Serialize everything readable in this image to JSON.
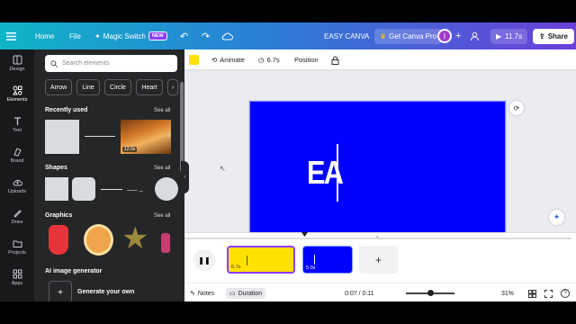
{
  "topbar": {
    "home": "Home",
    "file": "File",
    "magic_switch": "Magic Switch",
    "new_badge": "NEW",
    "title": "EASY CANVA",
    "get_pro": "Get Canva Pro",
    "avatar_initial": "I",
    "play_time": "11.7s",
    "share": "Share"
  },
  "rail": [
    "Design",
    "Elements",
    "Text",
    "Brand",
    "Uploads",
    "Draw",
    "Projects",
    "Apps"
  ],
  "panel": {
    "search_placeholder": "Search elements",
    "chips": [
      "Arrow",
      "Line",
      "Circle",
      "Heart"
    ],
    "recently_used": "Recently used",
    "shapes": "Shapes",
    "graphics": "Graphics",
    "see_all": "See all",
    "video_duration": "12.0s",
    "ai_generator": "AI image generator",
    "generate_your_own": "Generate your own"
  },
  "toolbar": {
    "color": "#ffe100",
    "animate": "Animate",
    "duration": "6.7s",
    "position": "Position"
  },
  "canvas": {
    "text": "EA",
    "bg_color": "#0000ff"
  },
  "timeline": {
    "clip1_duration": "6.7s",
    "clip1_color": "#ffe100",
    "clip2_duration": "5.0s",
    "clip2_color": "#0000ff",
    "notes": "Notes",
    "duration_label": "Duration",
    "time": "0:07 / 0:11",
    "zoom": "31%"
  }
}
